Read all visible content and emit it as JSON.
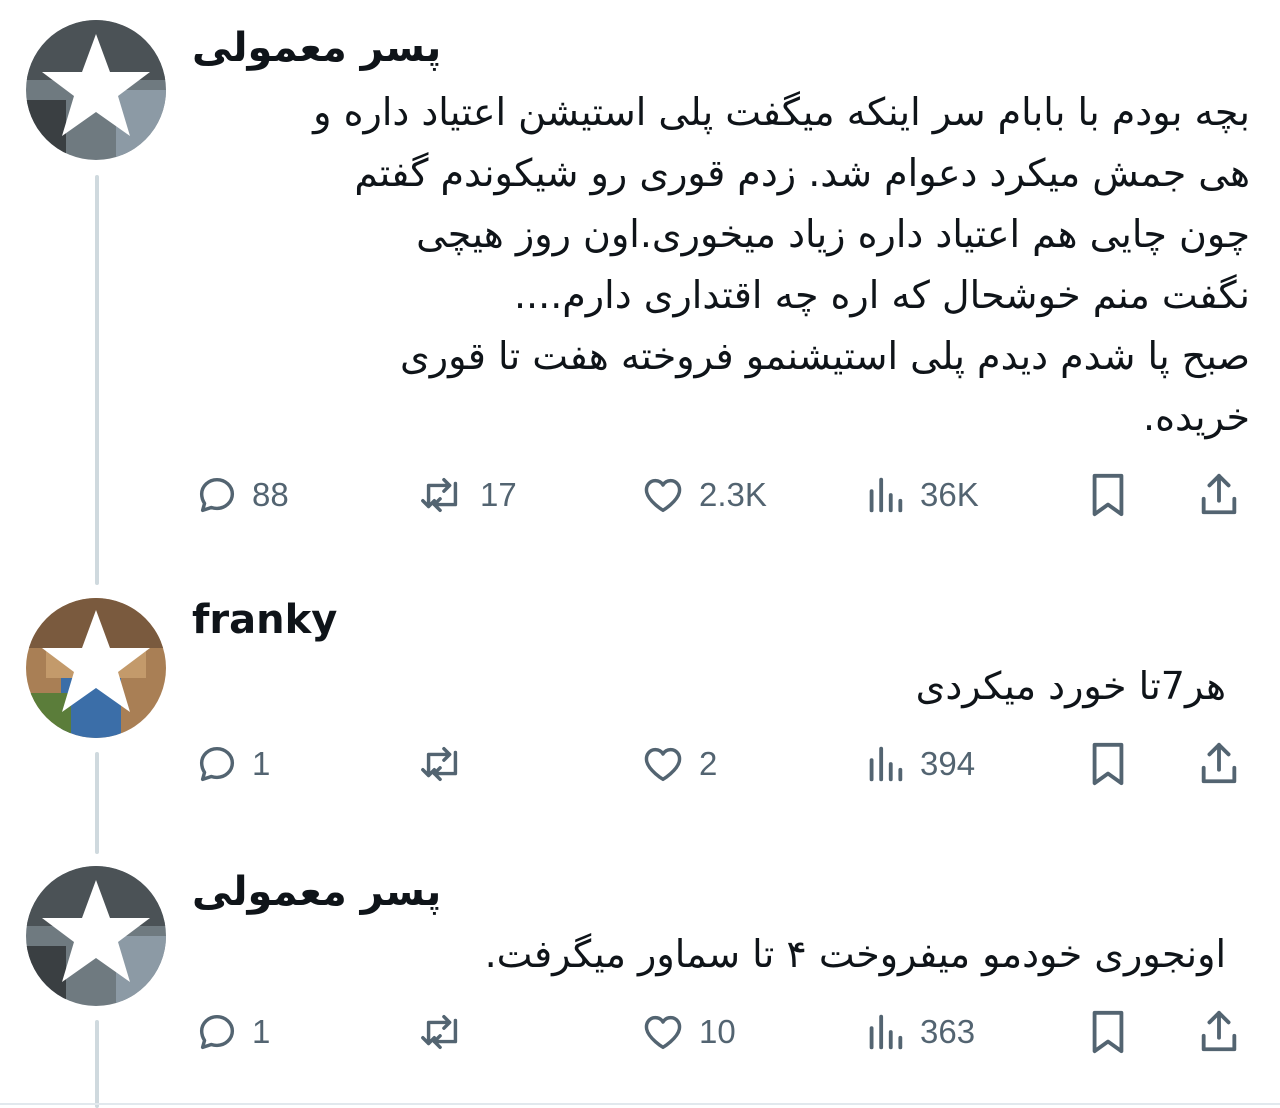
{
  "thread": [
    {
      "author": "پسر معمولی",
      "avatar_icon": "star-avatar-icon",
      "lines": [
        "بچه بودم با بابام سر اینکه میگفت پلی استیشن اعتیاد داره و",
        "هی جمش میکرد دعوام شد. زدم قوری رو شیکوندم گفتم",
        "چون چایی هم اعتیاد داره زیاد میخوری.اون روز هیچی",
        "نگفت منم خوشحال که اره چه اقتداری دارم....",
        "صبح پا شدم دیدم پلی استیشنمو فروخته هفت تا قوری",
        "خریده."
      ],
      "replies": "88",
      "reposts": "17",
      "likes": "2.3K",
      "views": "36K"
    },
    {
      "author": "franky",
      "avatar_icon": "star-avatar-icon",
      "lines": [
        "هر7تا خورد میکردی"
      ],
      "replies": "1",
      "reposts": "",
      "likes": "2",
      "views": "394"
    },
    {
      "author": "پسر معمولی",
      "avatar_icon": "star-avatar-icon",
      "lines": [
        "اونجوری خودمو میفروخت ۴ تا سماور میگرفت."
      ],
      "replies": "1",
      "reposts": "",
      "likes": "10",
      "views": "363"
    }
  ],
  "icons": {
    "reply": "reply-bubble-icon",
    "repost": "repost-arrows-icon",
    "like": "heart-icon",
    "views": "views-bars-icon",
    "bookmark": "bookmark-icon",
    "share": "share-upload-icon"
  },
  "colors": {
    "icon_gray": "#536471",
    "thread_line": "#cfd9de",
    "text": "#0f1419"
  }
}
